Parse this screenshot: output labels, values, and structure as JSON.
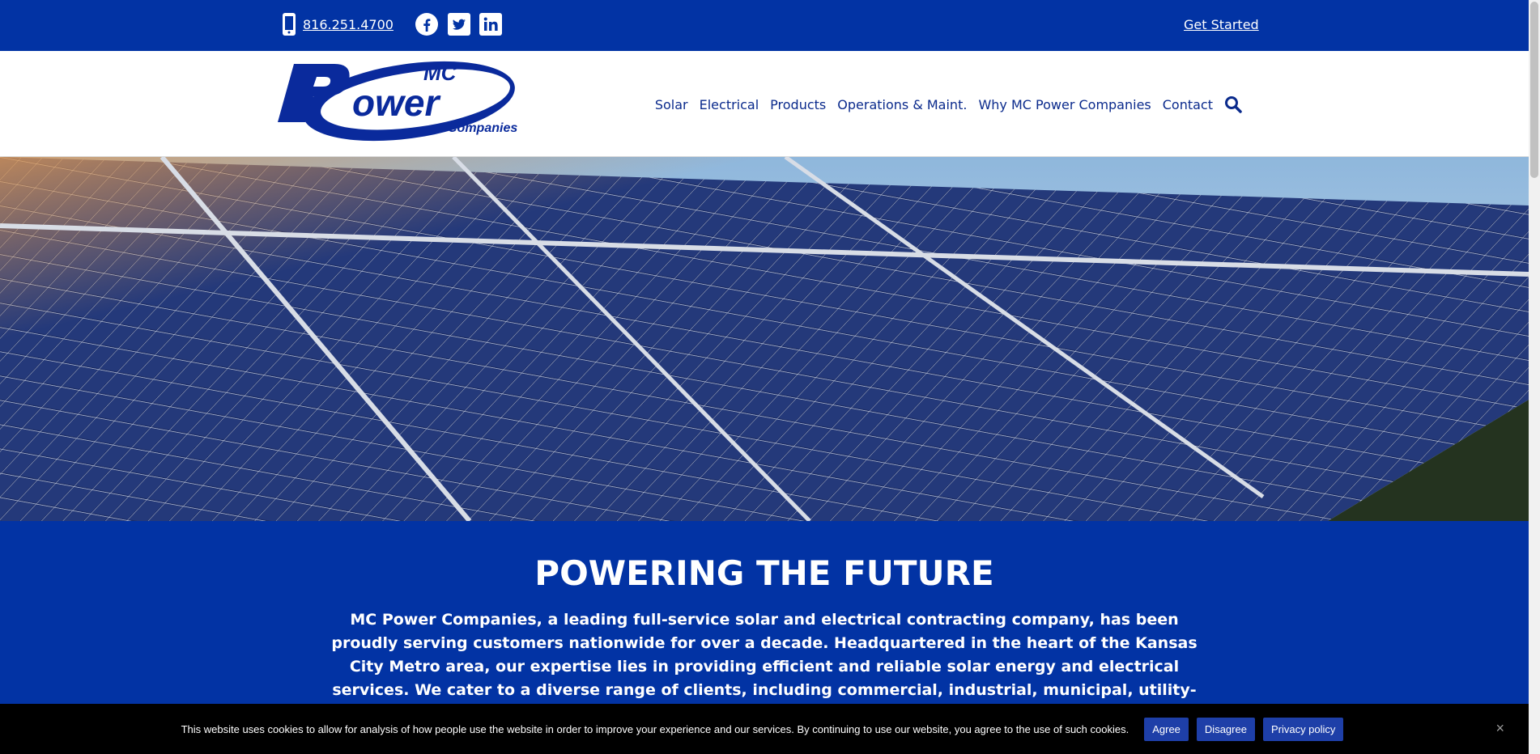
{
  "topbar": {
    "phone": "816.251.4700",
    "social_icons": [
      "facebook-icon",
      "twitter-icon",
      "linkedin-icon"
    ],
    "get_started": "Get Started"
  },
  "header": {
    "logo": {
      "top": "MC",
      "main": "Power",
      "sub": "Companies"
    },
    "nav": [
      "Solar",
      "Electrical",
      "Products",
      "Operations & Maint.",
      "Why MC Power Companies",
      "Contact"
    ]
  },
  "main": {
    "title": "POWERING THE FUTURE",
    "body": "MC Power Companies, a leading full-service solar and electrical contracting company, has been proudly serving customers nationwide for over a decade. Headquartered in the heart of the Kansas City Metro area, our expertise lies in providing efficient and reliable solar energy and electrical services. We cater to a diverse range of clients, including commercial, industrial, municipal, utility-scale, educational facilities, agricultural, and residential partners, all of whom trust us to help"
  },
  "cookie": {
    "text": "This website uses cookies to allow for analysis of how people use the website in order to improve your experience and our services. By continuing to use our website, you agree to the use of such cookies.",
    "agree": "Agree",
    "disagree": "Disagree",
    "privacy": "Privacy policy",
    "close": "×"
  },
  "colors": {
    "brand_blue": "#0233a4",
    "nav_text": "#0a2a8c",
    "cookie_bg": "#000000"
  }
}
